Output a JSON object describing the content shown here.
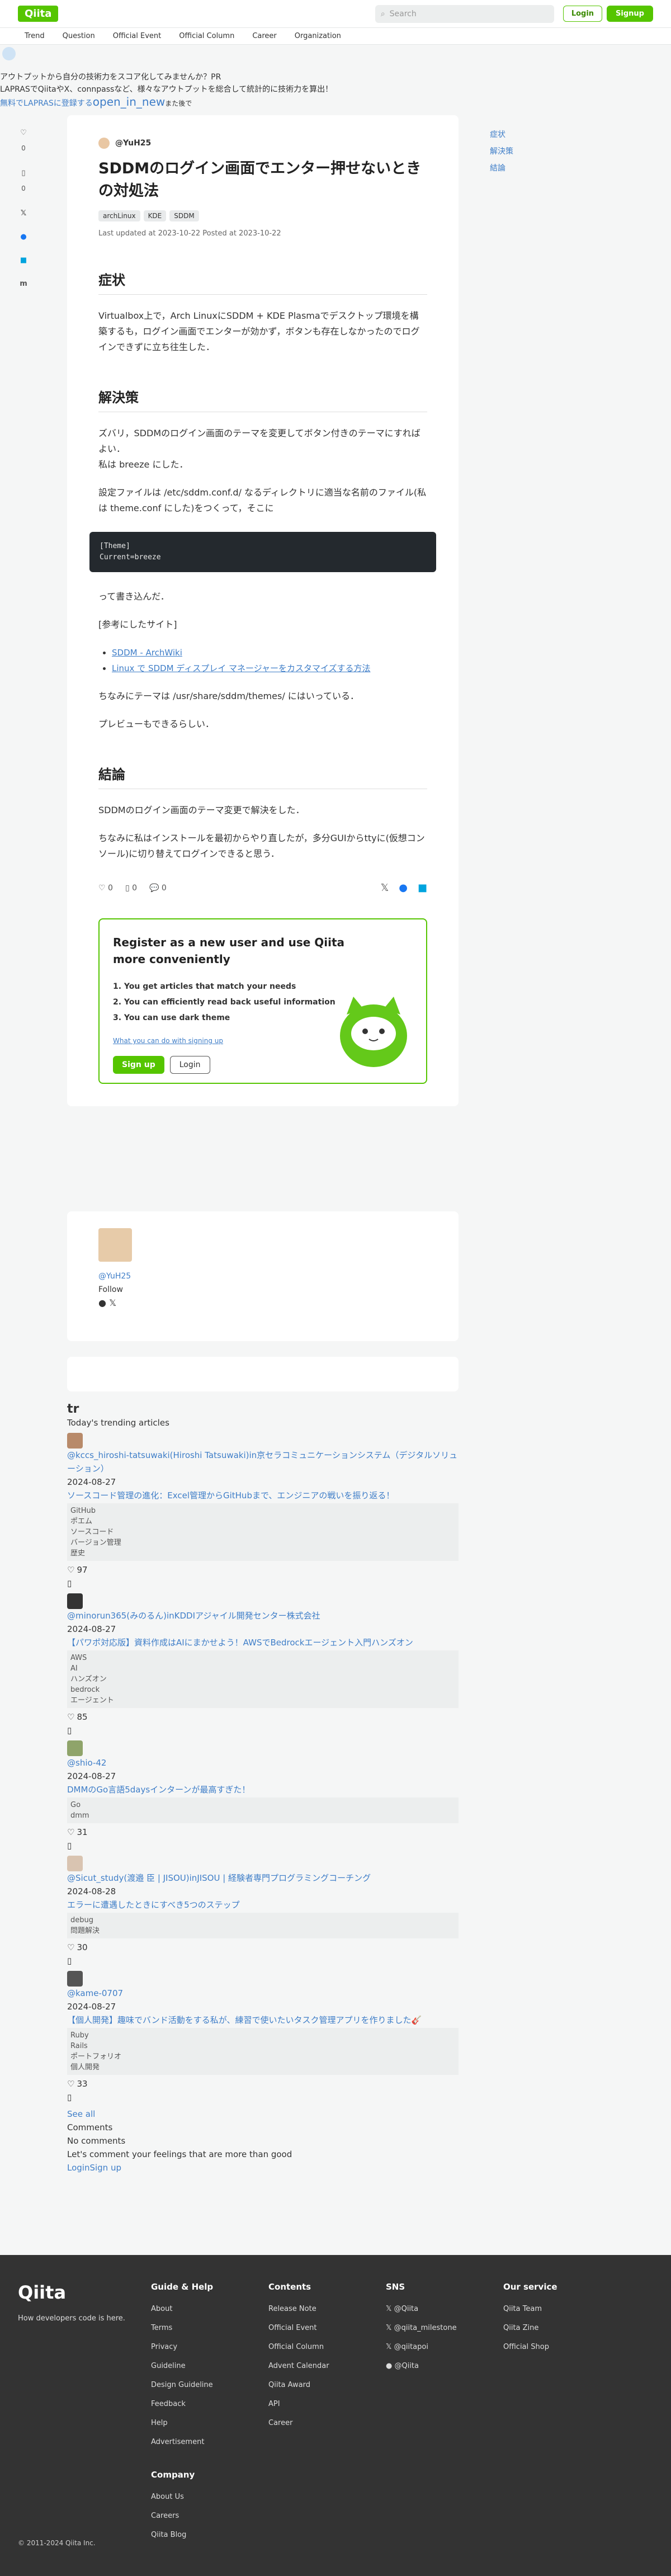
{
  "header": {
    "logo": "Qiita",
    "search_placeholder": "Search",
    "login": "Login",
    "signup": "Signup"
  },
  "nav": [
    "Trend",
    "Question",
    "Official Event",
    "Official Column",
    "Career",
    "Organization"
  ],
  "ad": {
    "line1": "アウトプットから自分の技術力をスコア化してみませんか？PR",
    "line2": "LAPRASでQiitaやX、connpassなど、様々なアウトプットを総合して統計的に技術力を算出！",
    "link1": "無料でLAPRASに登録する",
    "link2": "open_in_new",
    "note": "また後で"
  },
  "side": {
    "likes": "0",
    "stocks": "0"
  },
  "toc": [
    "症状",
    "解決策",
    "結論"
  ],
  "article": {
    "author": "@YuH25",
    "title": "SDDMのログイン画面でエンター押せないときの対処法",
    "tags": [
      "archLinux",
      "KDE",
      "SDDM"
    ],
    "dates": "Last updated at 2023-10-22  Posted at 2023-10-22",
    "h_symptom": "症状",
    "p_symptom": "Virtualbox上で，Arch LinuxにSDDM + KDE Plasmaでデスクトップ環境を構築するも，ログイン画面でエンターが効かず，ボタンも存在しなかったのでログインできずに立ち往生した．",
    "h_solution": "解決策",
    "p_solution1": "ズバリ，SDDMのログイン画面のテーマを変更してボタン付きのテーマにすればよい．",
    "p_solution2": "私は breeze にした．",
    "p_solution3": "設定ファイルは /etc/sddm.conf.d/ なるディレクトリに適当な名前のファイル(私は theme.conf にした)をつくって，そこに",
    "code_line1": "[Theme]",
    "code_line2": "Current=breeze",
    "p_after_code": "って書き込んだ．",
    "p_ref": "[参考にしたサイト]",
    "ref1": "SDDM - ArchWiki",
    "ref2": "Linux で SDDM ディスプレイ マネージャーをカスタマイズする方法",
    "p_theme": "ちなみにテーマは /usr/share/sddm/themes/ にはいっている．",
    "p_preview": "プレビューもできるらしい．",
    "h_conclusion": "結論",
    "p_conclusion1": "SDDMのログイン画面のテーマ変更で解決をした．",
    "p_conclusion2": "ちなみに私はインストールを最初からやり直したが，多分GUIからttyに(仮想コンソール)に切り替えてログインできると思う．",
    "like_count": "0",
    "stock_count": "0",
    "comment_count": "0"
  },
  "register": {
    "title": "Register as a new user and use Qiita more conveniently",
    "items": [
      "1. You get articles that match your needs",
      "2. You can efficiently read back useful information",
      "3. You can use dark theme"
    ],
    "what": "What you can do with signing up",
    "signup": "Sign up",
    "login": "Login"
  },
  "author_card": {
    "name": "@YuH25",
    "follow": "Follow"
  },
  "trending": {
    "heading": "Today's trending articles",
    "items": [
      {
        "user": "@kccs_hiroshi-tatsuwaki(Hiroshi Tatsuwaki)in京セラコミュニケーションシステム（デジタルソリューション）",
        "date": "2024-08-27",
        "title": "ソースコード管理の進化：Excel管理からGitHubまで、エンジニアの戦いを振り返る！",
        "tags": [
          "GitHub",
          "ポエム",
          "ソースコード",
          "バージョン管理",
          "歴史"
        ],
        "likes": "97"
      },
      {
        "user": "@minorun365(みのるん)inKDDIアジャイル開発センター株式会社",
        "date": "2024-08-27",
        "title": "【パワポ対応版】資料作成はAIにまかせよう！AWSでBedrockエージェント入門ハンズオン",
        "tags": [
          "AWS",
          "AI",
          "ハンズオン",
          "bedrock",
          "エージェント"
        ],
        "likes": "85"
      },
      {
        "user": "@shio-42",
        "date": "2024-08-27",
        "title": "DMMのGo言語5daysインターンが最高すぎた！",
        "tags": [
          "Go",
          "dmm"
        ],
        "likes": "31"
      },
      {
        "user": "@Sicut_study(渡邉 臣 | JISOU)inJISOU | 経験者専門プログラミングコーチング",
        "date": "2024-08-28",
        "title": "エラーに遭遇したときにすべき5つのステップ",
        "tags": [
          "debug",
          "問題解決"
        ],
        "likes": "30"
      },
      {
        "user": "@kame-0707",
        "date": "2024-08-27",
        "title": "【個人開発】趣味でバンド活動をする私が、練習で使いたいタスク管理アプリを作りました🎸",
        "tags": [
          "Ruby",
          "Rails",
          "ポートフォリオ",
          "個人開発"
        ],
        "likes": "33"
      }
    ],
    "see_all": "See all",
    "comments": "Comments",
    "no_comments": "No comments",
    "lets_comment": "Let's comment your feelings that are more than good",
    "login": "Login",
    "signup": "Sign up"
  },
  "footer": {
    "logo": "Qiita",
    "tagline": "How developers code is here.",
    "cols": [
      {
        "title": "Guide & Help",
        "items": [
          "About",
          "Terms",
          "Privacy",
          "Guideline",
          "Design Guideline",
          "Feedback",
          "Help",
          "Advertisement"
        ]
      },
      {
        "title": "Contents",
        "items": [
          "Release Note",
          "Official Event",
          "Official Column",
          "Advent Calendar",
          "Qiita Award",
          "API",
          "Career"
        ]
      },
      {
        "title": "SNS",
        "items": [
          "𝕏 @Qiita",
          "𝕏 @qiita_milestone",
          "𝕏 @qiitapoi",
          "● @Qiita"
        ]
      },
      {
        "title": "Our service",
        "items": [
          "Qiita Team",
          "Qiita Zine",
          "Official Shop"
        ]
      }
    ],
    "company": {
      "title": "Company",
      "items": [
        "About Us",
        "Careers",
        "Qiita Blog"
      ]
    },
    "copyright": "© 2011-2024 Qiita Inc."
  }
}
